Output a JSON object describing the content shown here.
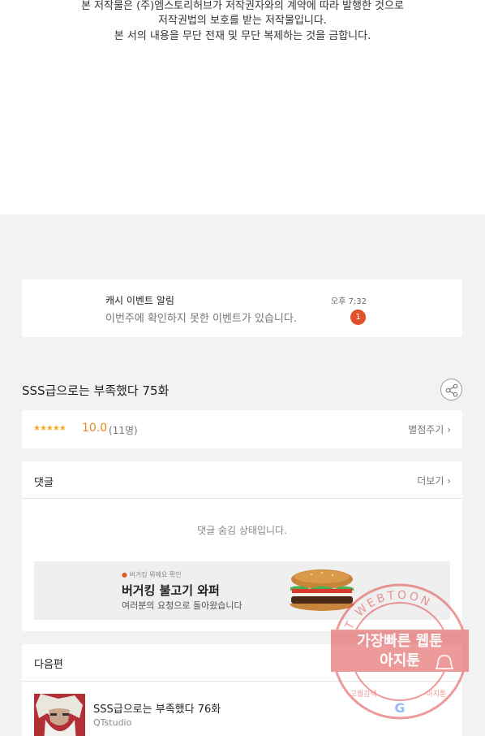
{
  "copyright": {
    "line1": "본 저작물은 (주)엠스토리허브가 저작권자와의 계약에 따라 발행한 것으로",
    "line2": "저작권법의 보호를 받는 저작물입니다.",
    "line3": "본 서의 내용을 무단 전재 및 무단 복제하는 것을 금합니다."
  },
  "notification": {
    "title": "캐시 이벤트 알림",
    "message": "이번주에 확인하지 못한 이벤트가 있습니다.",
    "time": "오후 7:32",
    "badge": "1"
  },
  "episode": {
    "title": "SSS급으로는 부족했다 75화",
    "share_icon": "share-icon"
  },
  "rating": {
    "stars": "★★★★★",
    "score": "10.0",
    "count": "(11명)",
    "rate_link": "별점주기",
    "star_color": "#f5a623"
  },
  "comments": {
    "header": "댓글",
    "more_label": "더보기",
    "hidden_message": "댓글 숨김 상태입니다."
  },
  "ad": {
    "small_label": "버거킹 뭐예요 확인",
    "headline": "버거킹 불고기 와퍼",
    "subline": "여러분의 요청으로 돌아왔습니다"
  },
  "next_episode": {
    "header": "다음편",
    "title": "SSS급으로는 부족했다 76화",
    "studio": "QTstudio"
  },
  "watermark": {
    "ring_text": "AJIT WEBTOON",
    "line1": "가장빠른 웹툰",
    "line2": "아지툰",
    "bottom_left": "고퀄검색",
    "bottom_right": "아지툰",
    "color": "#e04848"
  }
}
